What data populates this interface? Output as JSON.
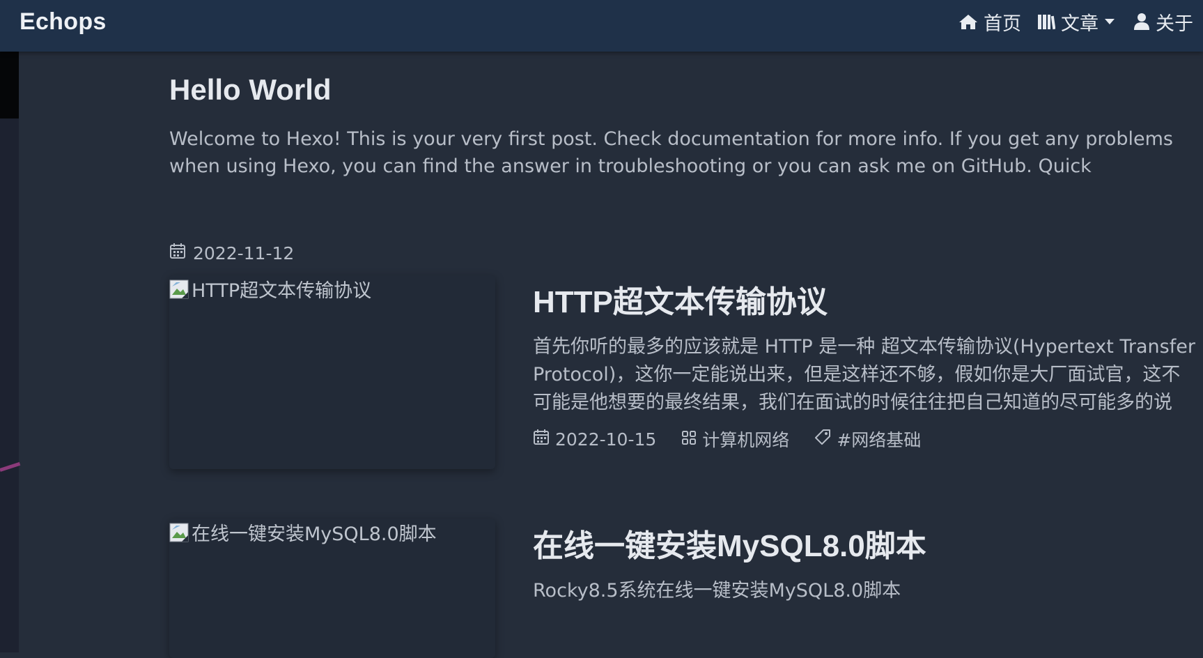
{
  "header": {
    "brand": "Echops",
    "nav": {
      "home": "首页",
      "posts": "文章",
      "about": "关于"
    }
  },
  "posts": [
    {
      "title": "Hello World",
      "excerpt": "Welcome to Hexo! This is your very first post. Check documentation for more info. If you get any problems when using Hexo, you can find the answer in troubleshooting or you can ask me on GitHub. Quick",
      "date": "2022-11-12"
    },
    {
      "title": "HTTP超文本传输协议",
      "image_alt": "HTTP超文本传输协议",
      "excerpt_lines": [
        "首先你听的最多的应该就是 HTTP 是一种 超文本传输协议(Hypertext Transfer",
        "Protocol)，这你一定能说出来，但是这样还不够，假如你是大厂面试官，这不",
        "可能是他想要的最终结果，我们在面试的时候往往把自己知道的尽可能多的说"
      ],
      "date": "2022-10-15",
      "category": "计算机网络",
      "tag": "#网络基础"
    },
    {
      "title": "在线一键安装MySQL8.0脚本",
      "image_alt": "在线一键安装MySQL8.0脚本",
      "excerpt": "Rocky8.5系统在线一键安装MySQL8.0脚本"
    }
  ]
}
